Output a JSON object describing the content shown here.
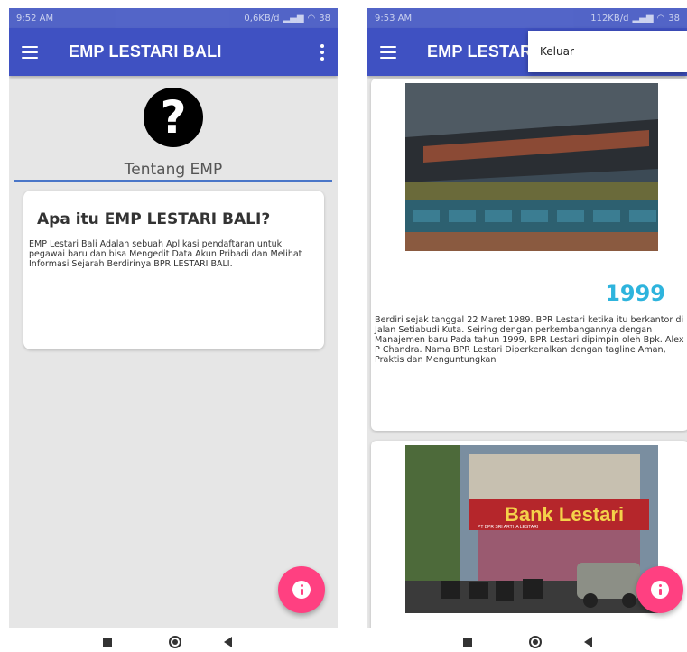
{
  "left_screen": {
    "status_bar": {
      "time": "9:52 AM",
      "network_speed": "0,6KB/d",
      "battery": "38"
    },
    "app_bar": {
      "title": "EMP LESTARI BALI",
      "menu_icon": "hamburger-icon",
      "overflow_icon": "more-vert-icon"
    },
    "help_icon": "?",
    "section_heading": "Tentang EMP",
    "card": {
      "title": "Apa itu EMP LESTARI BALI?",
      "body": "EMP Lestari Bali Adalah sebuah Aplikasi pendaftaran untuk pegawai baru dan bisa Mengedit Data Akun Pribadi dan Melihat Informasi Sejarah Berdirinya BPR LESTARI BALI."
    },
    "fab_icon": "info-icon"
  },
  "right_screen": {
    "status_bar": {
      "time": "9:53 AM",
      "network_speed": "112KB/d",
      "battery": "38"
    },
    "app_bar": {
      "title": "EMP LESTARI BALI"
    },
    "overflow_menu": {
      "items": [
        "Keluar"
      ]
    },
    "history": [
      {
        "year": "1999",
        "text": "Berdiri sejak tanggal 22 Maret 1989. BPR Lestari ketika itu berkantor di Jalan Setiabudi Kuta. Seiring dengan perkembangannya dengan Manajemen baru Pada tahun 1999, BPR Lestari dipimpin oleh Bpk. Alex P Chandra. Nama BPR Lestari Diperkenalkan dengan tagline Aman, Praktis dan Menguntungkan"
      },
      {
        "sign_text": "Bank Lestari",
        "sign_subtext": "PT BPR SRI ARTHA LESTARI"
      }
    ],
    "fab_icon": "info-icon"
  },
  "colors": {
    "app_bar": "#3f51c2",
    "accent": "#ff4081",
    "year": "#2eb4dd"
  }
}
